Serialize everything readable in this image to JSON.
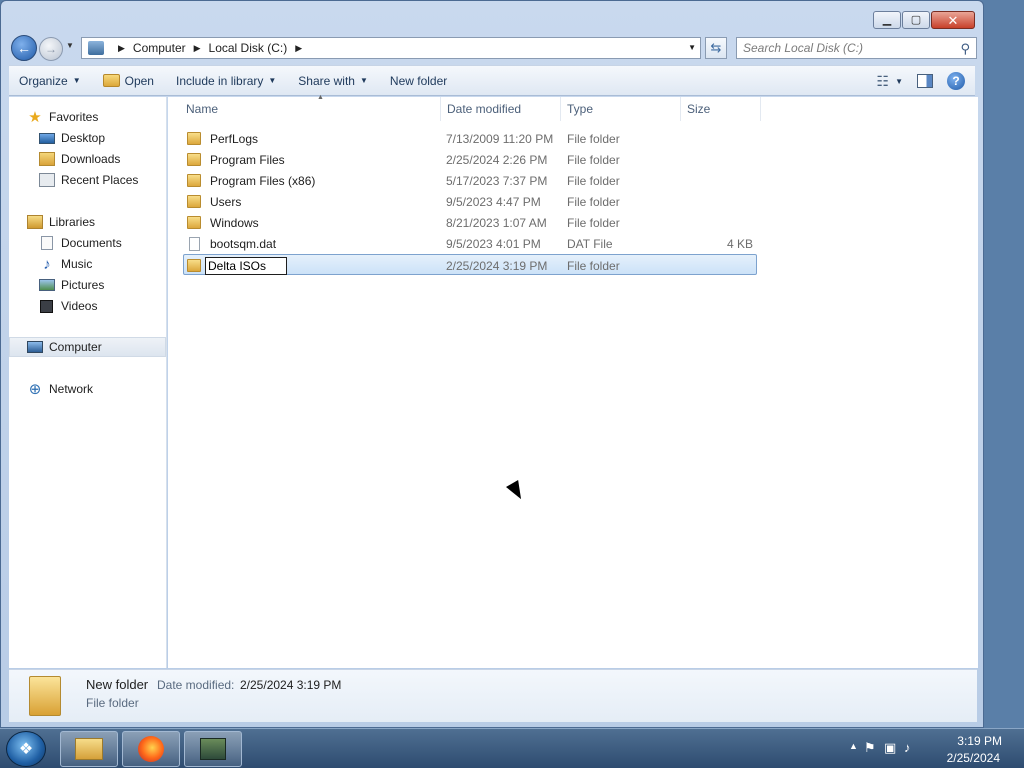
{
  "window": {
    "minimize_glyph": "▁",
    "maximize_glyph": "▢",
    "close_glyph": "✕"
  },
  "nav": {
    "back_glyph": "←",
    "forward_glyph": "→",
    "breadcrumb": [
      "Computer",
      "Local Disk (C:)"
    ],
    "search_placeholder": "Search Local Disk (C:)"
  },
  "toolbar": {
    "organize": "Organize",
    "open": "Open",
    "include_in_library": "Include in library",
    "share_with": "Share with",
    "new_folder": "New folder"
  },
  "sidebar": {
    "items": [
      {
        "label": "Favorites",
        "icon": "star-icon"
      },
      {
        "label": "Desktop",
        "icon": "desktop-icon"
      },
      {
        "label": "Downloads",
        "icon": "downloads-icon"
      },
      {
        "label": "Recent Places",
        "icon": "recent-places-icon"
      },
      {
        "label": "Libraries",
        "icon": "libraries-icon"
      },
      {
        "label": "Documents",
        "icon": "documents-icon"
      },
      {
        "label": "Music",
        "icon": "music-icon"
      },
      {
        "label": "Pictures",
        "icon": "pictures-icon"
      },
      {
        "label": "Videos",
        "icon": "videos-icon"
      },
      {
        "label": "Computer",
        "icon": "computer-icon"
      },
      {
        "label": "Network",
        "icon": "network-icon"
      }
    ]
  },
  "columns": {
    "name": "Name",
    "date_modified": "Date modified",
    "type": "Type",
    "size": "Size"
  },
  "files": [
    {
      "name": "PerfLogs",
      "date": "7/13/2009 11:20 PM",
      "type": "File folder",
      "size": ""
    },
    {
      "name": "Program Files",
      "date": "2/25/2024 2:26 PM",
      "type": "File folder",
      "size": ""
    },
    {
      "name": "Program Files (x86)",
      "date": "5/17/2023 7:37 PM",
      "type": "File folder",
      "size": ""
    },
    {
      "name": "Users",
      "date": "9/5/2023 4:47 PM",
      "type": "File folder",
      "size": ""
    },
    {
      "name": "Windows",
      "date": "8/21/2023 1:07 AM",
      "type": "File folder",
      "size": ""
    },
    {
      "name": "bootsqm.dat",
      "date": "9/5/2023 4:01 PM",
      "type": "DAT File",
      "size": "4 KB"
    },
    {
      "name": "Delta ISOs",
      "date": "2/25/2024 3:19 PM",
      "type": "File folder",
      "size": ""
    }
  ],
  "details": {
    "name": "New folder",
    "date_label": "Date modified:",
    "date": "2/25/2024 3:19 PM",
    "type": "File folder"
  },
  "taskbar": {
    "time": "3:19 PM",
    "date": "2/25/2024"
  },
  "colors": {
    "selection": "#cce2f8",
    "accent": "#1f5aa8"
  }
}
